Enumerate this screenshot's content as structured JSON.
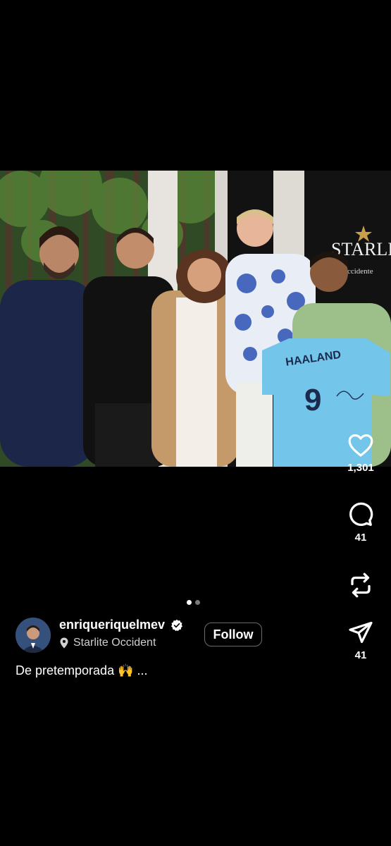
{
  "post": {
    "photo_alt": "",
    "jersey_name": "HAALAND",
    "jersey_number": "9",
    "sign_text": "STARLITE",
    "sign_subtext": "Occidente"
  },
  "actions": {
    "likes": "1,301",
    "comments": "41",
    "shares": "41"
  },
  "carousel": {
    "total": 2,
    "active": 1
  },
  "author": {
    "username": "enriqueriquelmev",
    "verified": true,
    "location": "Starlite Occident"
  },
  "follow_label": "Follow",
  "caption": "De pretemporada 🙌 ...",
  "colors": {
    "background": "#000000",
    "text": "#ffffff",
    "secondary": "#d0d0d0"
  }
}
